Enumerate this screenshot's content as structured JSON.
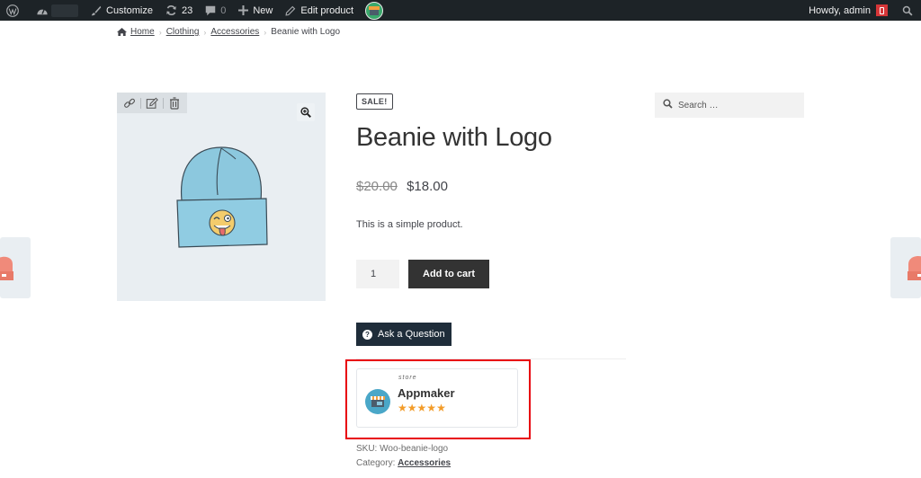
{
  "admin_bar": {
    "customize_label": "Customize",
    "updates_count": "23",
    "comments_count": "0",
    "new_label": "New",
    "edit_label": "Edit product",
    "greeting": "Howdy, admin"
  },
  "breadcrumb": {
    "items": [
      {
        "label": "Home"
      },
      {
        "label": "Clothing"
      },
      {
        "label": "Accessories"
      }
    ],
    "current": "Beanie with Logo",
    "separator": "›"
  },
  "product": {
    "badge": "SALE!",
    "title": "Beanie with Logo",
    "regular_price": "$20.00",
    "sale_price": "$18.00",
    "short_description": "This is a simple product.",
    "quantity": "1",
    "add_to_cart_label": "Add to cart",
    "ask_question_label": "Ask a Question",
    "sku_label": "SKU:",
    "sku_value": "Woo-beanie-logo",
    "category_label": "Category:",
    "category_value": "Accessories"
  },
  "store": {
    "label": "store",
    "name": "Appmaker",
    "rating": 5,
    "rating_max": 5,
    "star_color": "#f39c29"
  },
  "sidebar": {
    "search_placeholder": "Search …"
  },
  "colors": {
    "admin_bar_bg": "#1d2327",
    "highlight_border": "#e8000b",
    "button_dark": "#333333",
    "ask_button_bg": "#1f2d3a"
  }
}
